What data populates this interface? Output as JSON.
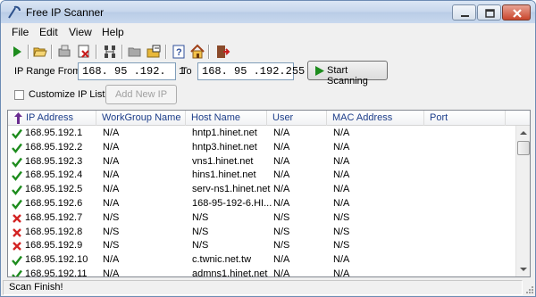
{
  "window": {
    "title": "Free IP Scanner"
  },
  "menu": {
    "file": "File",
    "edit": "Edit",
    "view": "View",
    "help": "Help"
  },
  "toolbar": {
    "icons": [
      "play-icon",
      "open-folder-icon",
      "save-icon",
      "delete-icon",
      "network-icon",
      "folder-icon",
      "export-icon",
      "help-icon",
      "home-icon",
      "exit-icon"
    ]
  },
  "range": {
    "from_label": "IP Range From",
    "from_value": "168. 95 .192.  1",
    "to_label": "To",
    "to_value": "168. 95 .192.255",
    "start_label": "Start Scanning"
  },
  "customize": {
    "label": "Customize IP List",
    "checked": false,
    "add_button": "Add New IP"
  },
  "table": {
    "columns": [
      "IP Address",
      "WorkGroup Name",
      "Host Name",
      "User",
      "MAC Address",
      "Port"
    ],
    "rows": [
      {
        "status": "ok",
        "ip": "168.95.192.1",
        "workgroup": "N/A",
        "host": "hntp1.hinet.net",
        "user": "N/A",
        "mac": "N/A",
        "port": ""
      },
      {
        "status": "ok",
        "ip": "168.95.192.2",
        "workgroup": "N/A",
        "host": "hntp3.hinet.net",
        "user": "N/A",
        "mac": "N/A",
        "port": ""
      },
      {
        "status": "ok",
        "ip": "168.95.192.3",
        "workgroup": "N/A",
        "host": "vns1.hinet.net",
        "user": "N/A",
        "mac": "N/A",
        "port": ""
      },
      {
        "status": "ok",
        "ip": "168.95.192.4",
        "workgroup": "N/A",
        "host": "hins1.hinet.net",
        "user": "N/A",
        "mac": "N/A",
        "port": ""
      },
      {
        "status": "ok",
        "ip": "168.95.192.5",
        "workgroup": "N/A",
        "host": "serv-ns1.hinet.net",
        "user": "N/A",
        "mac": "N/A",
        "port": ""
      },
      {
        "status": "ok",
        "ip": "168.95.192.6",
        "workgroup": "N/A",
        "host": "168-95-192-6.HI...",
        "user": "N/A",
        "mac": "N/A",
        "port": ""
      },
      {
        "status": "fail",
        "ip": "168.95.192.7",
        "workgroup": "N/S",
        "host": "N/S",
        "user": "N/S",
        "mac": "N/S",
        "port": ""
      },
      {
        "status": "fail",
        "ip": "168.95.192.8",
        "workgroup": "N/S",
        "host": "N/S",
        "user": "N/S",
        "mac": "N/S",
        "port": ""
      },
      {
        "status": "fail",
        "ip": "168.95.192.9",
        "workgroup": "N/S",
        "host": "N/S",
        "user": "N/S",
        "mac": "N/S",
        "port": ""
      },
      {
        "status": "ok",
        "ip": "168.95.192.10",
        "workgroup": "N/A",
        "host": "c.twnic.net.tw",
        "user": "N/A",
        "mac": "N/A",
        "port": ""
      },
      {
        "status": "ok",
        "ip": "168.95.192.11",
        "workgroup": "N/A",
        "host": "admns1.hinet.net",
        "user": "N/A",
        "mac": "N/A",
        "port": ""
      }
    ]
  },
  "status": {
    "text": "Scan Finish!"
  },
  "colors": {
    "ok": "#1d8c1d",
    "fail": "#d32323",
    "header_text": "#1d3e8a",
    "sort_arrow": "#6a2c91"
  }
}
